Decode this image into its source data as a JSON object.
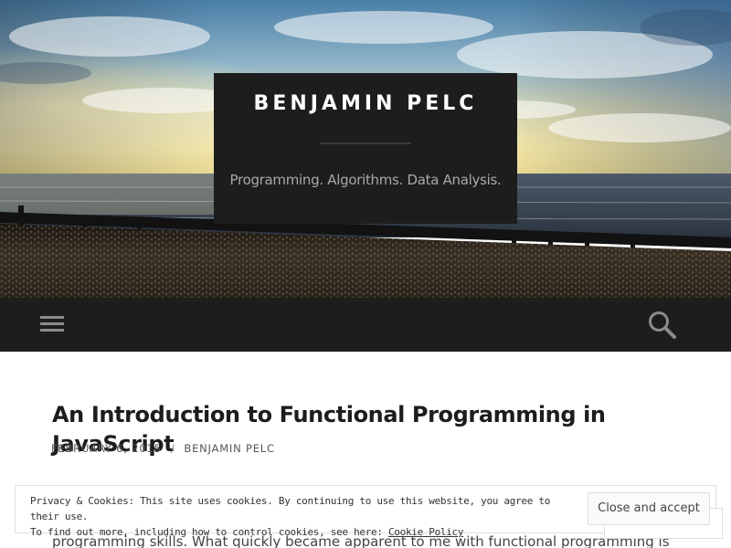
{
  "site": {
    "title": "BENJAMIN PELC",
    "tagline": "Programming. Algorithms. Data Analysis."
  },
  "nav": {
    "menu_icon": "hamburger-menu-icon",
    "search_icon": "search-icon"
  },
  "post": {
    "title": "An Introduction to Functional Programming in JavaScript",
    "date": "FEBRUARY 6, 2015",
    "separator": "/",
    "author": "BENJAMIN PELC",
    "excerpt": "programming skills. What quickly became apparent to me with functional programming is"
  },
  "cookie_notice": {
    "line1": "Privacy & Cookies: This site uses cookies. By continuing to use this website, you agree to their use.",
    "line2_prefix": "To find out more, including how to control cookies, see here: ",
    "policy_link": "Cookie Policy",
    "accept_label": "Close and accept"
  },
  "colors": {
    "header_box": "#1d1d1d",
    "navbar": "#1d1d1d",
    "title_text": "#ffffff",
    "tagline_text": "#a8a8a8"
  }
}
